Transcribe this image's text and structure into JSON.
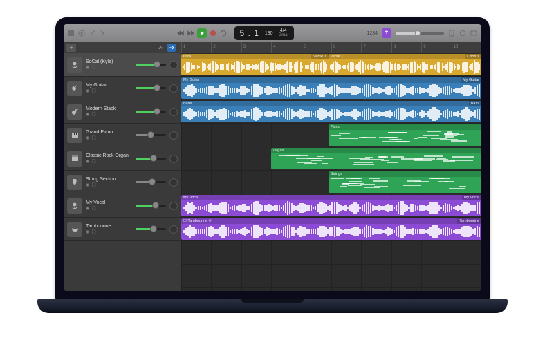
{
  "toolbar": {
    "position": "5 . 1",
    "tempo": "130",
    "time_sig": "4/4",
    "key": "Gmaj",
    "count_label": "1234",
    "cycle_badge": "∞"
  },
  "ruler": {
    "bars": [
      1,
      2,
      3,
      4,
      5,
      6,
      7,
      8,
      9,
      10
    ]
  },
  "playhead_pct": 49,
  "tracks": [
    {
      "name": "SoCal (Kyle)",
      "icon": "mic",
      "sel": true,
      "vol": 70,
      "color": "green"
    },
    {
      "name": "My Guitar",
      "icon": "guitar",
      "sel": false,
      "vol": 70,
      "color": "green"
    },
    {
      "name": "Modern Stack",
      "icon": "bass",
      "sel": false,
      "vol": 70,
      "color": "green"
    },
    {
      "name": "Grand Piano",
      "icon": "piano",
      "sel": false,
      "vol": 50,
      "color": "grey"
    },
    {
      "name": "Classic Rock Organ",
      "icon": "organ",
      "sel": false,
      "vol": 60,
      "color": "green"
    },
    {
      "name": "String Section",
      "icon": "strings",
      "sel": false,
      "vol": 55,
      "color": "grey"
    },
    {
      "name": "My Vocal",
      "icon": "mic",
      "sel": false,
      "vol": 65,
      "color": "green"
    },
    {
      "name": "Tambourine",
      "icon": "perc",
      "sel": false,
      "vol": 60,
      "color": "green"
    }
  ],
  "regions": [
    {
      "track": 0,
      "start": 0,
      "end": 49,
      "color": "yellow",
      "label": "Intro",
      "labelR": "Verse 1",
      "type": "audio"
    },
    {
      "track": 0,
      "start": 49,
      "end": 100,
      "color": "yellow",
      "label": "Verse 1",
      "labelR": "Chorus",
      "type": "audio"
    },
    {
      "track": 1,
      "start": 0,
      "end": 100,
      "color": "blue",
      "label": "My Guitar",
      "labelR": "My Guitar",
      "type": "audio"
    },
    {
      "track": 2,
      "start": 0,
      "end": 100,
      "color": "blue",
      "label": "Bass",
      "labelR": "Bass",
      "type": "audio"
    },
    {
      "track": 3,
      "start": 49,
      "end": 100,
      "color": "green",
      "label": "Piano",
      "type": "midi"
    },
    {
      "track": 4,
      "start": 30,
      "end": 100,
      "color": "green",
      "label": "Organ",
      "type": "midi"
    },
    {
      "track": 5,
      "start": 49,
      "end": 100,
      "color": "green",
      "label": "Strings",
      "type": "midi"
    },
    {
      "track": 6,
      "start": 0,
      "end": 100,
      "color": "purple",
      "label": "My Vocal",
      "labelR": "My Vocal",
      "type": "audio"
    },
    {
      "track": 7,
      "start": 0,
      "end": 100,
      "color": "purple",
      "label": "☐ Tambourine  ⟳",
      "labelR": "Tambourine",
      "type": "audio"
    }
  ],
  "sub": {
    "add": "+"
  }
}
